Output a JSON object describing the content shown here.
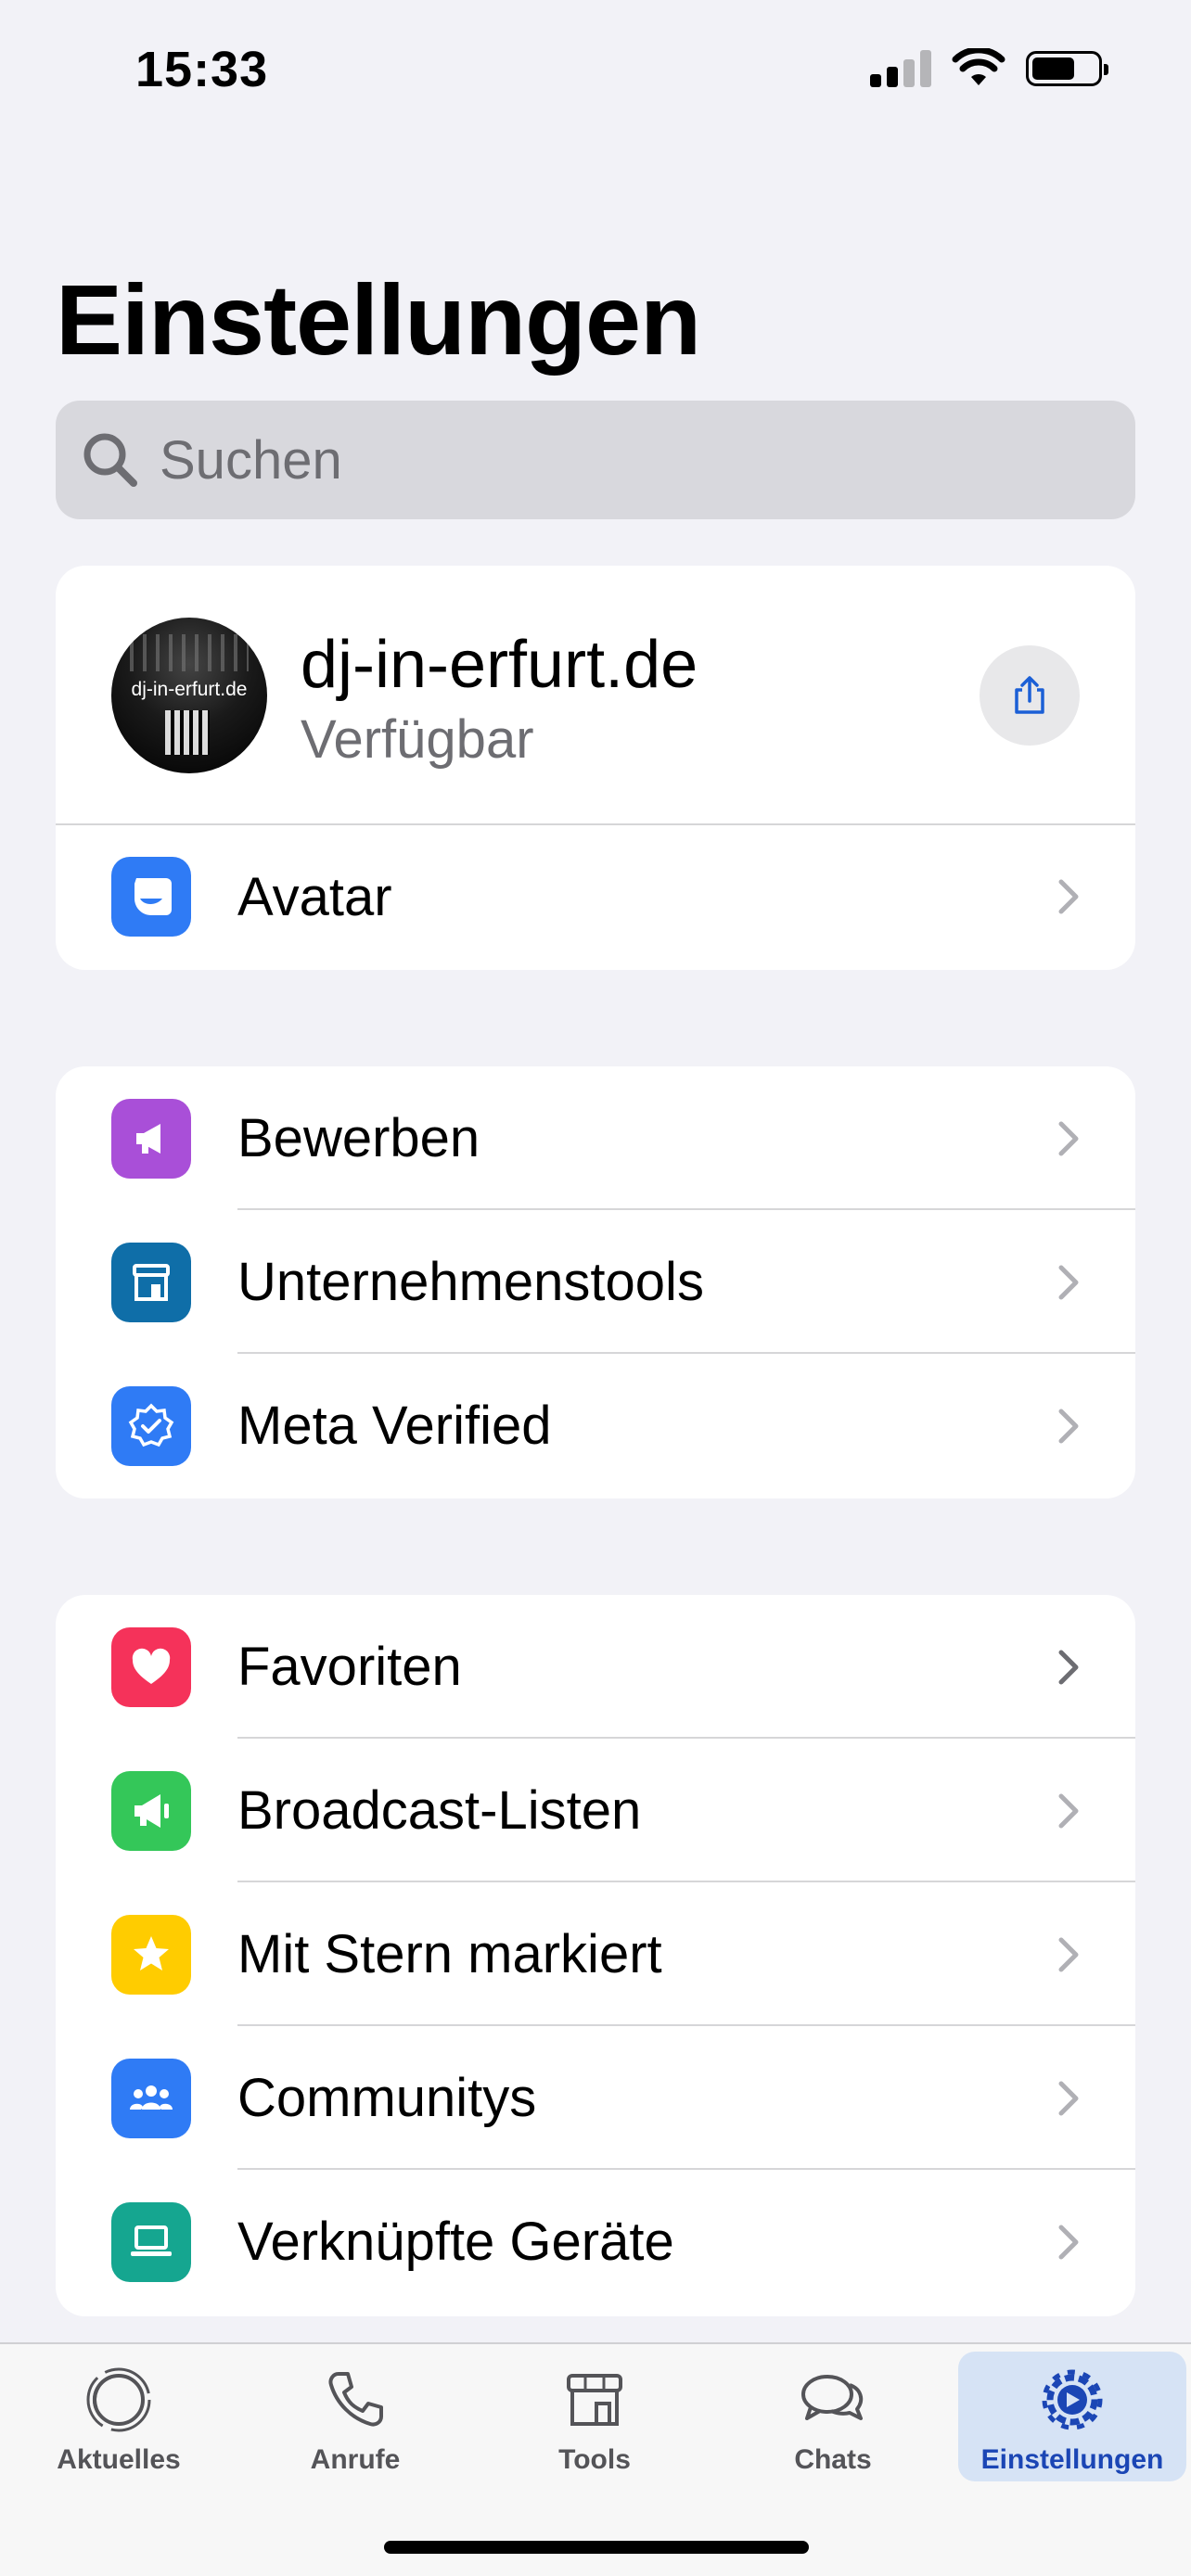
{
  "status_bar": {
    "time": "15:33",
    "signal_icon": "cellular-signal-icon",
    "wifi_icon": "wifi-icon",
    "battery_icon": "battery-icon"
  },
  "header": {
    "title": "Einstellungen"
  },
  "search": {
    "placeholder": "Suchen",
    "icon": "search-icon"
  },
  "profile": {
    "avatar_text": "dj-in-erfurt.de",
    "name": "dj-in-erfurt.de",
    "status": "Verfügbar",
    "share_icon": "share-icon"
  },
  "profile_items": [
    {
      "label": "Avatar",
      "icon": "avatar-icon",
      "color": "#2f7bf5"
    }
  ],
  "group1": [
    {
      "label": "Bewerben",
      "icon": "megaphone-icon",
      "color": "#a94fd8"
    },
    {
      "label": "Unternehmenstools",
      "icon": "storefront-icon",
      "color": "#0f6ea8"
    },
    {
      "label": "Meta Verified",
      "icon": "verified-badge-icon",
      "color": "#2f7bf5"
    }
  ],
  "group2": [
    {
      "label": "Favoriten",
      "icon": "heart-icon",
      "color": "#f5325a"
    },
    {
      "label": "Broadcast-Listen",
      "icon": "broadcast-icon",
      "color": "#34c759"
    },
    {
      "label": "Mit Stern markiert",
      "icon": "star-icon",
      "color": "#ffcc00"
    },
    {
      "label": "Communitys",
      "icon": "community-icon",
      "color": "#2f7bf5"
    },
    {
      "label": "Verknüpfte Geräte",
      "icon": "laptop-icon",
      "color": "#15a690"
    }
  ],
  "tab_bar": {
    "tabs": [
      {
        "label": "Aktuelles",
        "icon": "status-ring-icon"
      },
      {
        "label": "Anrufe",
        "icon": "phone-icon"
      },
      {
        "label": "Tools",
        "icon": "store-icon"
      },
      {
        "label": "Chats",
        "icon": "chat-bubbles-icon"
      },
      {
        "label": "Einstellungen",
        "icon": "settings-gear-icon",
        "active": true
      }
    ],
    "active_color": "#1b46b5"
  }
}
